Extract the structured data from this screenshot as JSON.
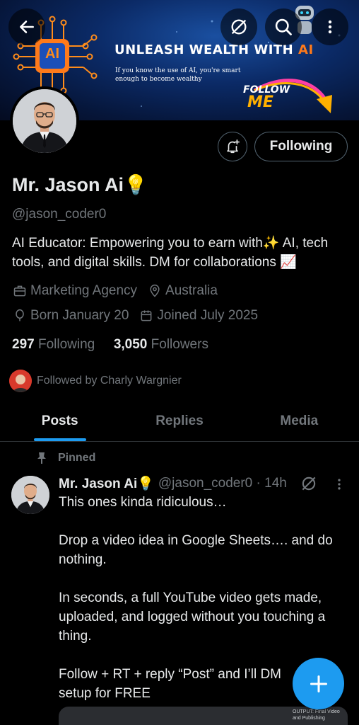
{
  "banner": {
    "title_main": "UNLEASH WEALTH WITH ",
    "title_ai": "AI",
    "subtitle": "If you know the use of AI, you're smart enough to become wealthy",
    "follow_line1": "FOLLOW",
    "follow_line2": "ME",
    "logo_text": "AI"
  },
  "nav": {
    "back_icon": "arrow-left-icon",
    "grok_icon": "grok-icon",
    "search_icon": "search-icon",
    "more_icon": "more-vertical-icon"
  },
  "profile": {
    "name": "Mr. Jason Ai",
    "name_emoji": "💡",
    "handle": "@jason_coder0",
    "bio": "AI Educator: Empowering you to earn with✨  AI, tech tools, and digital skills. DM for collaborations 📈",
    "category": "Marketing Agency",
    "location": "Australia",
    "born": "Born January 20",
    "joined": "Joined July 2025",
    "following_count": "297",
    "following_label": "Following",
    "followers_count": "3,050",
    "followers_label": "Followers",
    "followed_by": "Followed by Charly Wargnier",
    "following_button": "Following"
  },
  "tabs": [
    {
      "label": "Posts",
      "active": true
    },
    {
      "label": "Replies",
      "active": false
    },
    {
      "label": "Media",
      "active": false
    }
  ],
  "post": {
    "pinned_label": "Pinned",
    "author_name": "Mr. Jason Ai💡",
    "author_handle": "@jason_coder0 · 14h",
    "text": "This ones kinda ridiculous…\n\nDrop a video idea in Google Sheets…. and do nothing.\n\nIn seconds, a full YouTube video gets made, uploaded, and logged without you touching a thing.\n\nFollow + RT + reply “Post” and I’ll DM       full setup for FREE",
    "media_caption": "OUTPUT: Final Video and Publishing"
  },
  "colors": {
    "accent": "#1d9bf0",
    "text_primary": "#e7e9ea",
    "text_secondary": "#71767b",
    "banner_orange": "#ff7a1a"
  }
}
